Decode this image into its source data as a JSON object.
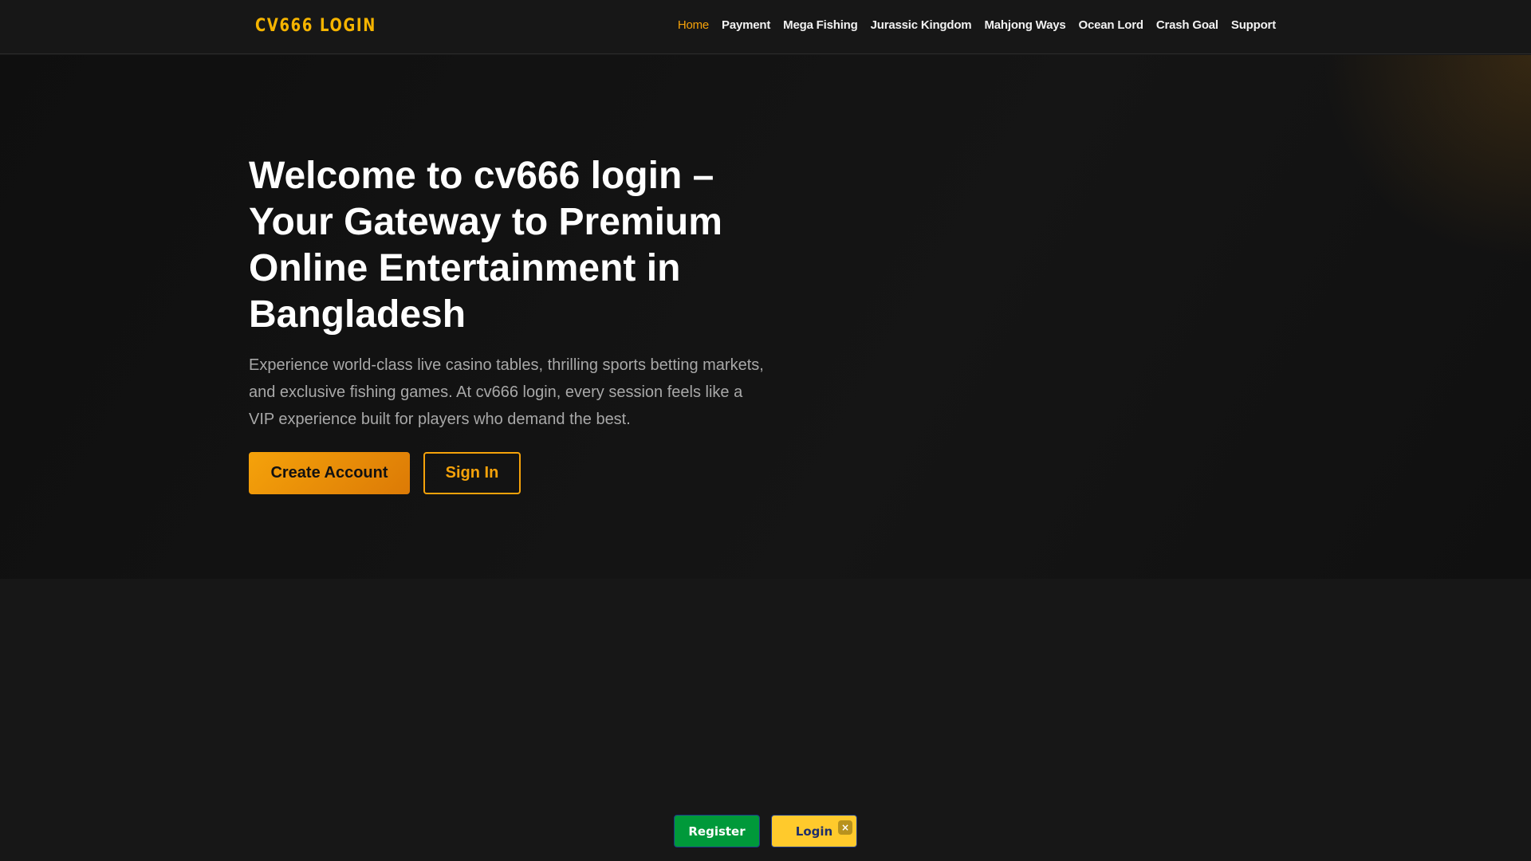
{
  "header": {
    "logo": "CV666 LOGIN",
    "nav": [
      "Home",
      "Payment",
      "Mega Fishing",
      "Jurassic Kingdom",
      "Mahjong Ways",
      "Ocean Lord",
      "Crash Goal",
      "Support"
    ]
  },
  "hero": {
    "title": "Welcome to cv666 login – Your Gateway to Premium Online Entertainment in Bangladesh",
    "lead": "Experience world-class live casino tables, thrilling sports betting markets, and exclusive fishing games. At cv666 login, every session feels like a VIP experience built for players who demand the best.",
    "create_label": "Create Account",
    "signin_label": "Sign In"
  },
  "bottom_bar": {
    "register_label": "Register",
    "login_label": "Login",
    "close_glyph": "×"
  }
}
